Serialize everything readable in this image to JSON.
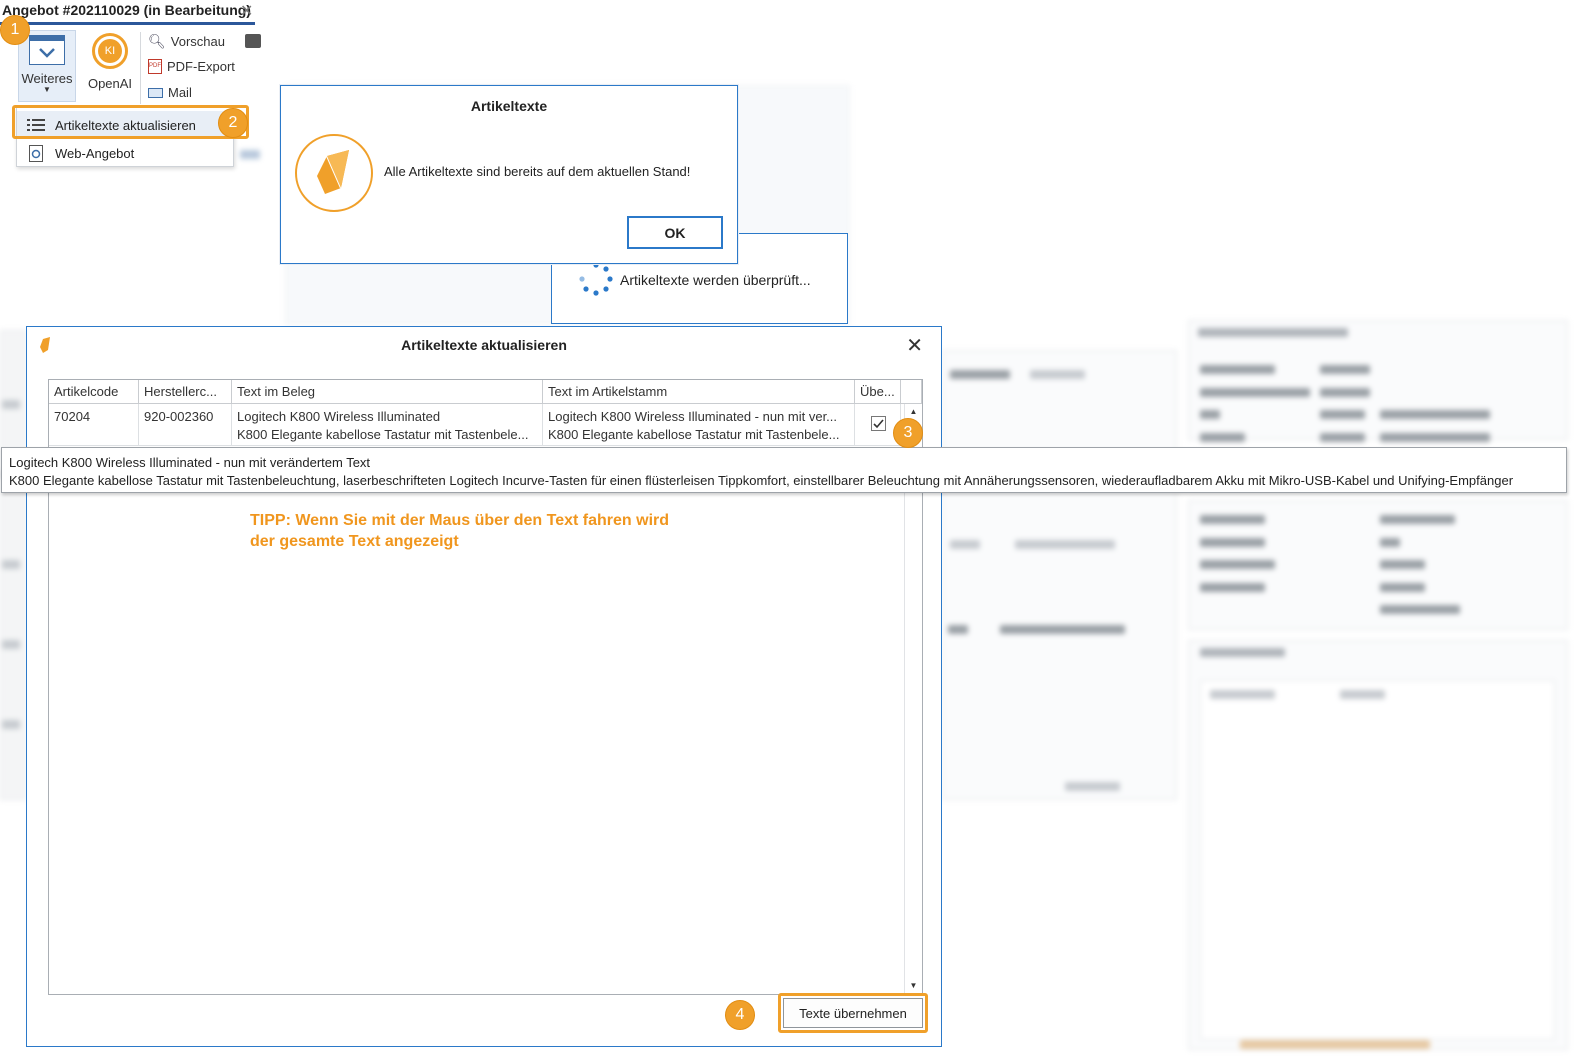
{
  "tab": {
    "title": "Angebot #202110029 (in Bearbeitung)",
    "close": "✕"
  },
  "ribbon": {
    "weiteres_label": "Weiteres",
    "openai_label": "OpenAI",
    "openai_badge": "KI",
    "vorschau": "Vorschau",
    "pdf_export": "PDF-Export",
    "mail": "Mail"
  },
  "menu": {
    "items": [
      {
        "label": "Artikeltexte aktualisieren"
      },
      {
        "label": "Web-Angebot"
      }
    ]
  },
  "badges": [
    "1",
    "2",
    "3",
    "4"
  ],
  "message_box": {
    "title": "Artikeltexte",
    "text": "Alle Artikeltexte sind bereits auf dem aktuellen Stand!",
    "ok": "OK"
  },
  "busy": {
    "text": "Artikeltexte werden überprüft..."
  },
  "dialog": {
    "title": "Artikeltexte aktualisieren",
    "close": "✕",
    "columns": [
      "Artikelcode",
      "Herstellerc...",
      "Text im Beleg",
      "Text im Artikelstamm",
      "Übe..."
    ],
    "rows": [
      {
        "artikelcode": "70204",
        "herstellercode": "920-002360",
        "text_beleg_1": "Logitech K800 Wireless Illuminated",
        "text_beleg_2": "K800 Elegante kabellose Tastatur mit Tastenbele...",
        "text_stamm_1": "Logitech K800 Wireless Illuminated - nun mit ver...",
        "text_stamm_2": "K800 Elegante kabellose Tastatur mit Tastenbele...",
        "uebernehmen": true
      }
    ],
    "apply_button": "Texte übernehmen"
  },
  "tooltip": {
    "line1": "Logitech K800 Wireless Illuminated - nun mit verändertem Text",
    "line2": "K800 Elegante kabellose Tastatur mit Tastenbeleuchtung, laserbeschrifteten Logitech Incurve-Tasten für einen flüsterleisen Tippkomfort, einstellbarer Beleuchtung mit Annäherungssensoren, wiederaufladbarem Akku mit Mikro-USB-Kabel und Unifying-Empfänger"
  },
  "tipp": {
    "line1": "TIPP: Wenn Sie mit der Maus über den Text fahren wird",
    "line2": "der gesamte Text angezeigt"
  },
  "colors": {
    "accent_orange": "#f0a02a",
    "dialog_border": "#2b79c9",
    "tipp_text": "#f0961e",
    "tab_underline": "#2b579a"
  }
}
